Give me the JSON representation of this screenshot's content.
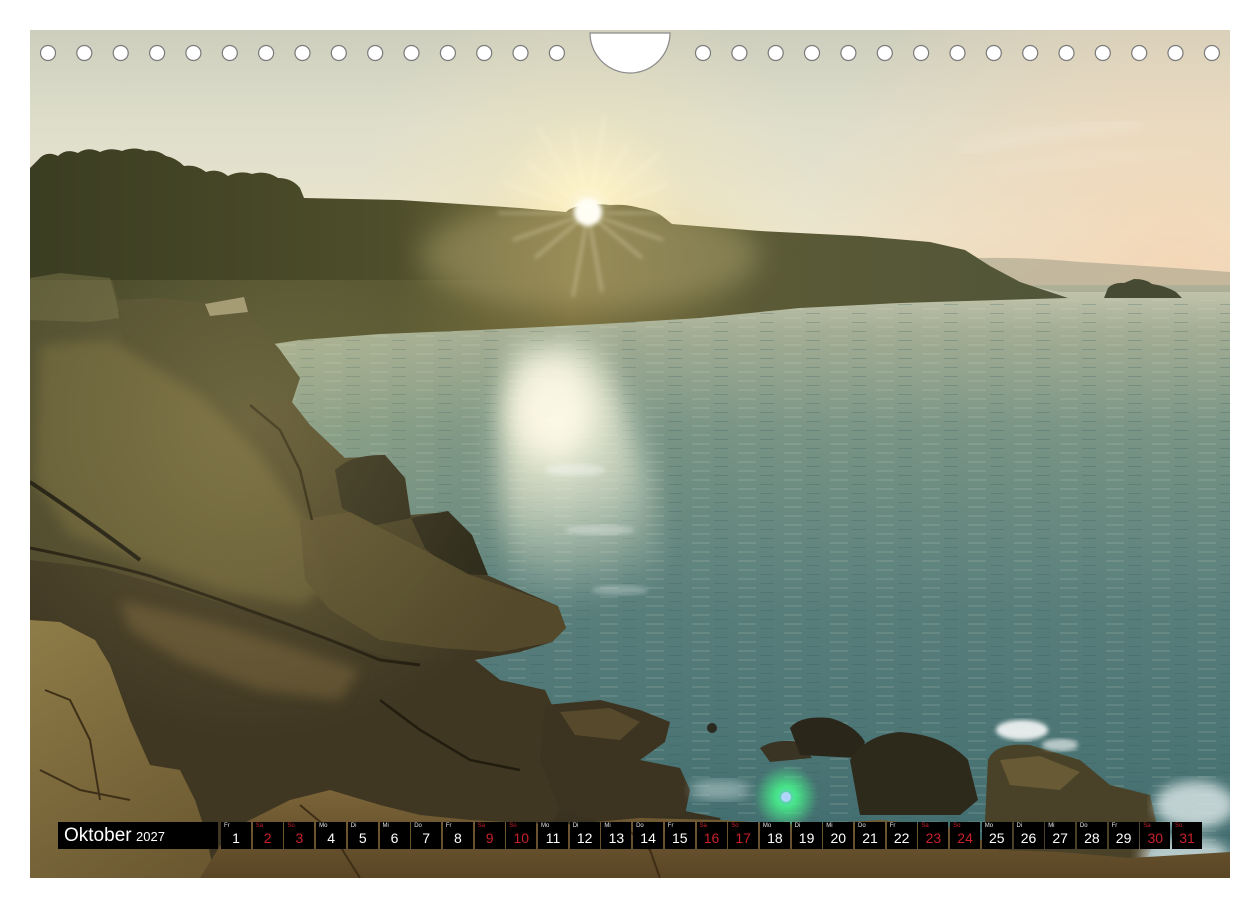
{
  "calendar": {
    "month": "Oktober",
    "year": "2027",
    "strip_color": "#000000",
    "text_color": "#ffffff",
    "weekend_color": "#c8202a",
    "days": [
      {
        "weekday": "Fr",
        "day": "1",
        "weekend": false
      },
      {
        "weekday": "Sa",
        "day": "2",
        "weekend": true
      },
      {
        "weekday": "So",
        "day": "3",
        "weekend": true
      },
      {
        "weekday": "Mo",
        "day": "4",
        "weekend": false
      },
      {
        "weekday": "Di",
        "day": "5",
        "weekend": false
      },
      {
        "weekday": "Mi",
        "day": "6",
        "weekend": false
      },
      {
        "weekday": "Do",
        "day": "7",
        "weekend": false
      },
      {
        "weekday": "Fr",
        "day": "8",
        "weekend": false
      },
      {
        "weekday": "Sa",
        "day": "9",
        "weekend": true
      },
      {
        "weekday": "So",
        "day": "10",
        "weekend": true
      },
      {
        "weekday": "Mo",
        "day": "11",
        "weekend": false
      },
      {
        "weekday": "Di",
        "day": "12",
        "weekend": false
      },
      {
        "weekday": "Mi",
        "day": "13",
        "weekend": false
      },
      {
        "weekday": "Do",
        "day": "14",
        "weekend": false
      },
      {
        "weekday": "Fr",
        "day": "15",
        "weekend": false
      },
      {
        "weekday": "Sa",
        "day": "16",
        "weekend": true
      },
      {
        "weekday": "So",
        "day": "17",
        "weekend": true
      },
      {
        "weekday": "Mo",
        "day": "18",
        "weekend": false
      },
      {
        "weekday": "Di",
        "day": "19",
        "weekend": false
      },
      {
        "weekday": "Mi",
        "day": "20",
        "weekend": false
      },
      {
        "weekday": "Do",
        "day": "21",
        "weekend": false
      },
      {
        "weekday": "Fr",
        "day": "22",
        "weekend": false
      },
      {
        "weekday": "Sa",
        "day": "23",
        "weekend": true
      },
      {
        "weekday": "So",
        "day": "24",
        "weekend": true
      },
      {
        "weekday": "Mo",
        "day": "25",
        "weekend": false
      },
      {
        "weekday": "Di",
        "day": "26",
        "weekend": false
      },
      {
        "weekday": "Mi",
        "day": "27",
        "weekend": false
      },
      {
        "weekday": "Do",
        "day": "28",
        "weekend": false
      },
      {
        "weekday": "Fr",
        "day": "29",
        "weekend": false
      },
      {
        "weekday": "Sa",
        "day": "30",
        "weekend": true
      },
      {
        "weekday": "So",
        "day": "31",
        "weekend": true
      }
    ]
  }
}
